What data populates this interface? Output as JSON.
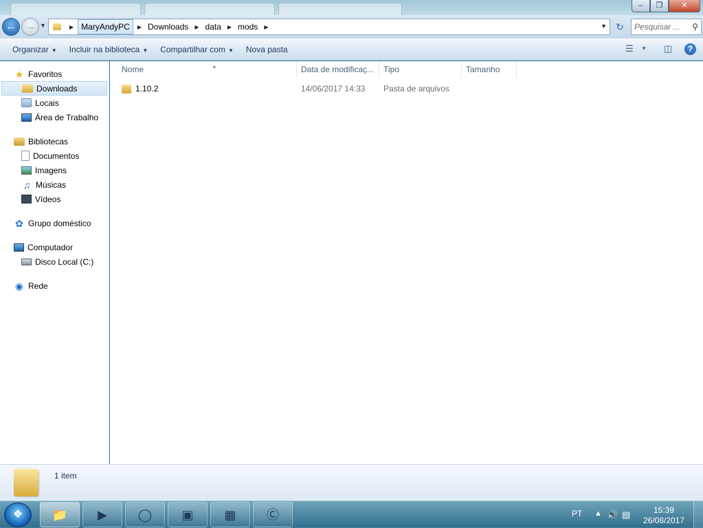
{
  "window": {
    "caption_buttons": {
      "minimize": "–",
      "maximize": "❐",
      "close": "✕"
    }
  },
  "navbar": {
    "breadcrumbs": [
      "MaryAndyPC",
      "Downloads",
      "data",
      "mods"
    ],
    "search_placeholder": "Pesquisar ..."
  },
  "commandbar": {
    "organize": "Organizar",
    "include_library": "Incluir na biblioteca",
    "share": "Compartilhar com",
    "new_folder": "Nova pasta"
  },
  "sidebar": {
    "favorites": {
      "label": "Favoritos",
      "items": [
        "Downloads",
        "Locais",
        "Área de Trabalho"
      ]
    },
    "libraries": {
      "label": "Bibliotecas",
      "items": [
        "Documentos",
        "Imagens",
        "Músicas",
        "Vídeos"
      ]
    },
    "homegroup": {
      "label": "Grupo doméstico"
    },
    "computer": {
      "label": "Computador",
      "items": [
        "Disco Local (C:)"
      ]
    },
    "network": {
      "label": "Rede"
    }
  },
  "columns": [
    "Nome",
    "Data de modificaç...",
    "Tipo",
    "Tamanho"
  ],
  "files": [
    {
      "name": "1.10.2",
      "date": "14/06/2017 14:33",
      "type": "Pasta de arquivos",
      "size": ""
    }
  ],
  "details": {
    "count": "1 item"
  },
  "taskbar": {
    "language": "PT",
    "time": "15:39",
    "date": "26/08/2017"
  }
}
